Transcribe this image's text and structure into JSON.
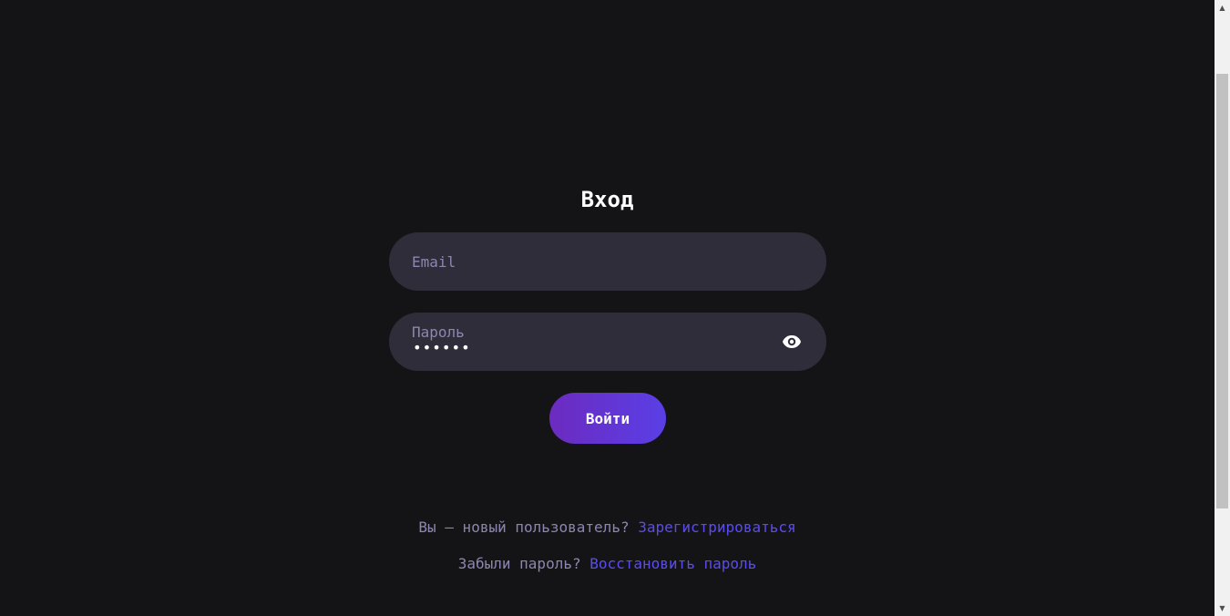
{
  "login": {
    "title": "Вход",
    "email_placeholder": "Email",
    "password_label": "Пароль",
    "password_value": "••••••",
    "submit_label": "Войти",
    "show_password_icon": "eye-icon"
  },
  "links": {
    "register_prompt": "Вы — новый пользователь? ",
    "register_link": "Зарегистрироваться",
    "forgot_prompt": "Забыли пароль? ",
    "forgot_link": "Восстановить пароль"
  },
  "colors": {
    "background": "#141417",
    "field": "#2e2d39",
    "muted_text": "#8e86b0",
    "link": "#5b4cf0",
    "button_gradient_start": "#6c2bc0",
    "button_gradient_end": "#5a3fe6"
  },
  "scrollbar": {
    "up_arrow": "▲",
    "down_arrow": "▼"
  }
}
